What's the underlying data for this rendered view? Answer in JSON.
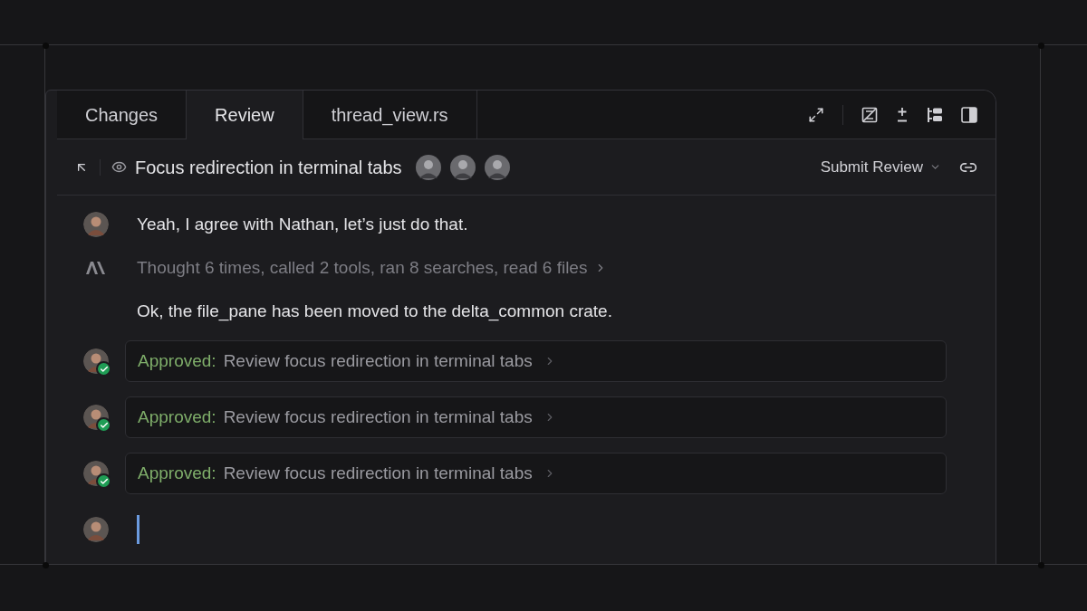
{
  "tabs": [
    {
      "label": "Changes",
      "selected": false
    },
    {
      "label": "Review",
      "selected": true
    },
    {
      "label": "thread_view.rs",
      "selected": false
    }
  ],
  "header": {
    "title": "Focus redirection in terminal tabs",
    "submit_label": "Submit Review"
  },
  "messages": [
    {
      "kind": "user",
      "text": "Yeah, I agree with Nathan, let’s just do that."
    },
    {
      "kind": "agent_summary",
      "text": "Thought 6 times, called 2 tools, ran 8 searches, read 6 files"
    },
    {
      "kind": "agent",
      "text": "Ok, the file_pane has been moved to the delta_common crate."
    },
    {
      "kind": "approval",
      "status": "Approved:",
      "text": "Review focus redirection in terminal tabs"
    },
    {
      "kind": "approval",
      "status": "Approved:",
      "text": "Review focus redirection in terminal tabs"
    },
    {
      "kind": "approval",
      "status": "Approved:",
      "text": "Review focus redirection in terminal tabs"
    },
    {
      "kind": "input"
    }
  ]
}
